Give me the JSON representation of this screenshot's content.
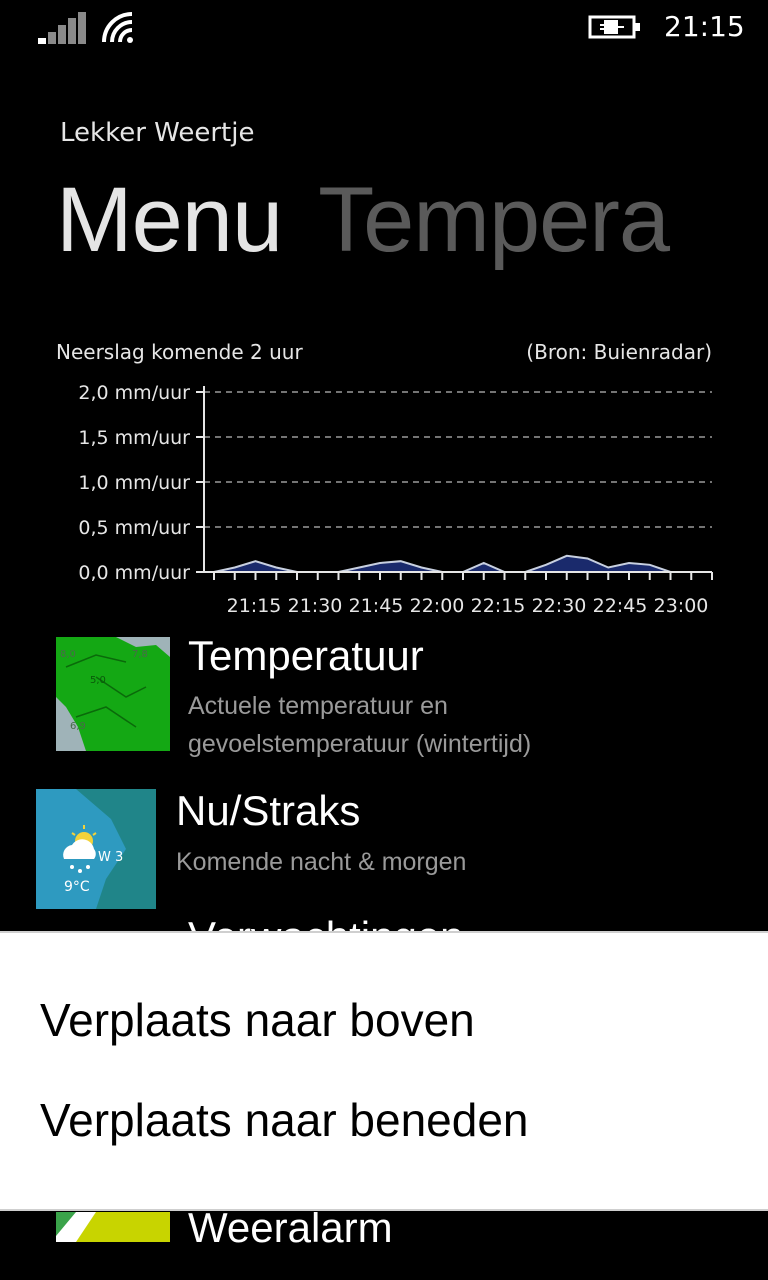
{
  "status_bar": {
    "time": "21:15",
    "icons": [
      "signal-icon",
      "wifi-icon",
      "battery-charging-icon"
    ]
  },
  "app": {
    "title": "Lekker Weertje"
  },
  "pivot": {
    "active": "Menu",
    "next": "Tempera"
  },
  "chart": {
    "title": "Neerslag komende 2 uur",
    "source": "(Bron: Buienradar)"
  },
  "chart_data": {
    "type": "area",
    "title": "Neerslag komende 2 uur",
    "y_tick_labels": [
      "0,0 mm/uur",
      "0,5 mm/uur",
      "1,0 mm/uur",
      "1,5 mm/uur",
      "2,0 mm/uur"
    ],
    "x_tick_labels": [
      "21:15",
      "21:30",
      "21:45",
      "22:00",
      "22:15",
      "22:30",
      "22:45",
      "23:00"
    ],
    "ylim": [
      0,
      2.0
    ],
    "grid": true,
    "x": [
      "21:15",
      "21:20",
      "21:25",
      "21:30",
      "21:35",
      "21:40",
      "21:45",
      "21:50",
      "21:55",
      "22:00",
      "22:05",
      "22:10",
      "22:15",
      "22:20",
      "22:25",
      "22:30",
      "22:35",
      "22:40",
      "22:45",
      "22:50",
      "22:55",
      "23:00",
      "23:05",
      "23:10",
      "23:15"
    ],
    "series": [
      {
        "values": [
          0.0,
          0.05,
          0.12,
          0.05,
          0.0,
          0.0,
          0.0,
          0.05,
          0.1,
          0.12,
          0.05,
          0.0,
          0.0,
          0.1,
          0.0,
          0.0,
          0.08,
          0.18,
          0.15,
          0.05,
          0.1,
          0.08,
          0.0,
          0.0,
          0.0
        ]
      }
    ],
    "colors": {
      "area": "#1a2a6c",
      "line": "#c8d0e0"
    }
  },
  "menu": {
    "items": [
      {
        "title": "Temperatuur",
        "desc_line1": "Actuele temperatuur en",
        "desc_line2": "gevoelstemperatuur (wintertijd)",
        "thumb_labels": [
          "8,0",
          "7,8",
          "5,0",
          "6,9"
        ]
      },
      {
        "title": "Nu/Straks",
        "desc_line1": "Komende nacht & morgen",
        "thumb_labels": [
          "W 3",
          "9°C"
        ]
      },
      {
        "title": "Weeralarm"
      }
    ],
    "peek_title": "Verwachtingen"
  },
  "context_menu": {
    "items": [
      "Verplaats naar boven",
      "Verplaats naar beneden"
    ]
  }
}
